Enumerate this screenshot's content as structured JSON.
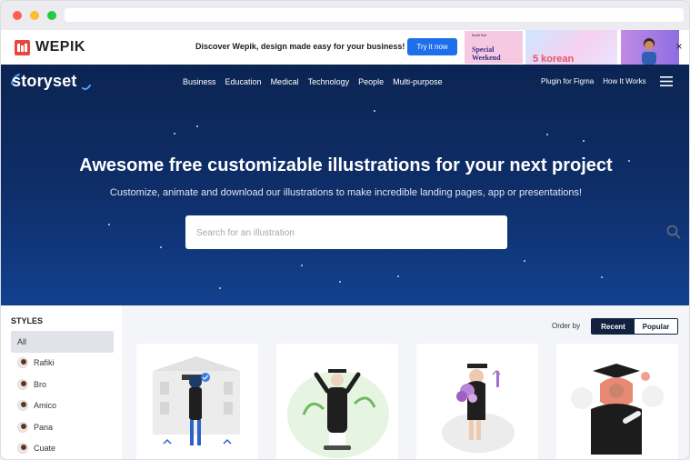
{
  "ad": {
    "brand": "WEPIK",
    "message": "Discover Wepik, design made easy for your business!",
    "cta": "Try it now",
    "banner_card1_small": "Build Bar",
    "banner_card1_title": "Special Weekend",
    "banner_card2_title": "5 korean",
    "close": "×"
  },
  "nav": {
    "brand": "storyset",
    "items": [
      "Business",
      "Education",
      "Medical",
      "Technology",
      "People",
      "Multi-purpose"
    ],
    "right": [
      "Plugin for Figma",
      "How It Works"
    ]
  },
  "hero": {
    "title": "Awesome free customizable illustrations for your next project",
    "subtitle": "Customize, animate and download our illustrations to make incredible landing pages, app or presentations!",
    "search_placeholder": "Search for an illustration"
  },
  "sidebar": {
    "title": "STYLES",
    "items": [
      "All",
      "Rafiki",
      "Bro",
      "Amico",
      "Pana",
      "Cuate"
    ],
    "active": "All"
  },
  "content": {
    "order_label": "Order by",
    "order_options": [
      "Recent",
      "Popular"
    ],
    "order_selected": "Recent"
  },
  "colors": {
    "hero_dark": "#0b2452",
    "accent": "#1f6feb",
    "segment_dark": "#11213f"
  }
}
